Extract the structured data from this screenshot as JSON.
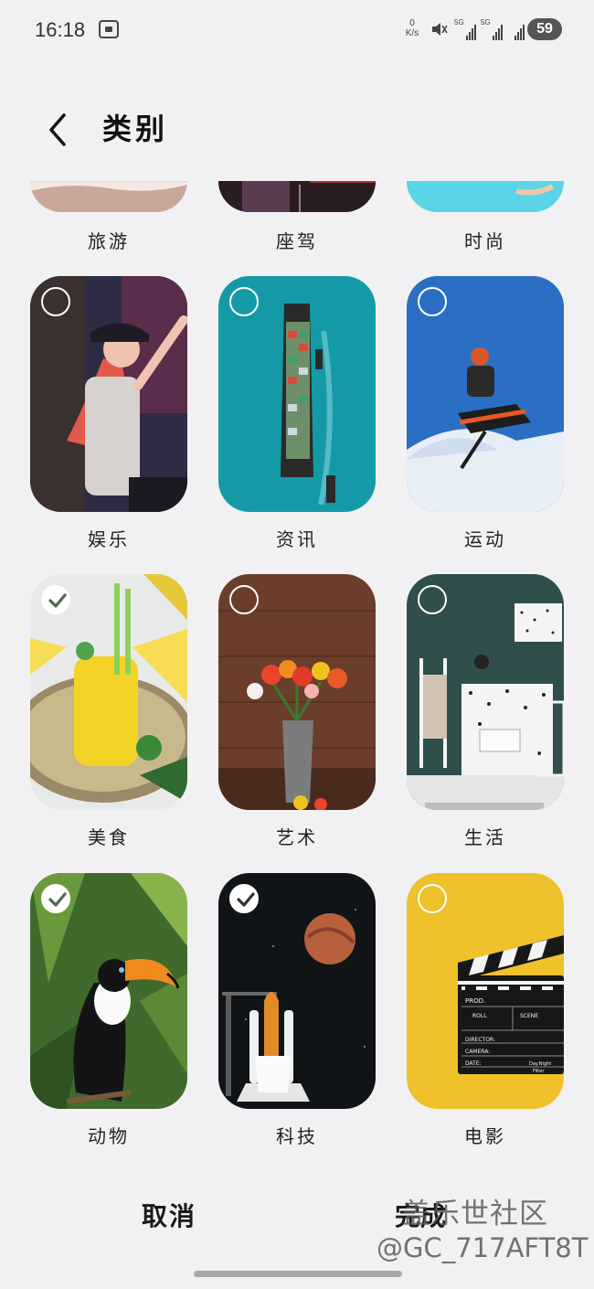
{
  "status_bar": {
    "time": "16:18",
    "net_speed_value": "0",
    "net_speed_unit": "K/s",
    "sim1_label": "5G",
    "sim2_label": "5G",
    "battery": "59"
  },
  "header": {
    "title": "类别"
  },
  "categories": [
    {
      "label": "旅游",
      "selected": false
    },
    {
      "label": "座驾",
      "selected": false
    },
    {
      "label": "时尚",
      "selected": false
    },
    {
      "label": "娱乐",
      "selected": false
    },
    {
      "label": "资讯",
      "selected": false
    },
    {
      "label": "运动",
      "selected": false
    },
    {
      "label": "美食",
      "selected": true
    },
    {
      "label": "艺术",
      "selected": false
    },
    {
      "label": "生活",
      "selected": false
    },
    {
      "label": "动物",
      "selected": true
    },
    {
      "label": "科技",
      "selected": true
    },
    {
      "label": "电影",
      "selected": false
    }
  ],
  "movie_clapper": {
    "prod": "PROD.",
    "roll": "ROLL",
    "scene": "SCENE",
    "director": "DIRECTOR:",
    "camera": "CAMERA:",
    "date": "DATE:",
    "day_night": "Day.Night",
    "filter": "Filter"
  },
  "footer": {
    "cancel_label": "取消",
    "done_label": "完成"
  },
  "watermark": {
    "site": "盖乐世社区",
    "user": "@GC_717AFT8T"
  }
}
